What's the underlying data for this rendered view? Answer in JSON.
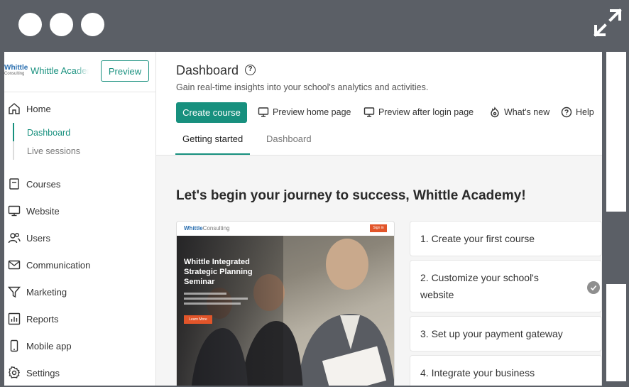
{
  "sidebar": {
    "logo_top": "Whittle",
    "logo_bottom": "Consulting",
    "school_name": "Whittle Academy",
    "preview_label": "Preview",
    "items": [
      {
        "label": "Home",
        "icon": "home-icon"
      },
      {
        "label": "Courses",
        "icon": "book-icon"
      },
      {
        "label": "Website",
        "icon": "monitor-icon"
      },
      {
        "label": "Users",
        "icon": "users-icon"
      },
      {
        "label": "Communication",
        "icon": "mail-icon"
      },
      {
        "label": "Marketing",
        "icon": "funnel-icon"
      },
      {
        "label": "Reports",
        "icon": "bar-chart-icon"
      },
      {
        "label": "Mobile app",
        "icon": "phone-icon"
      },
      {
        "label": "Settings",
        "icon": "gear-icon"
      }
    ],
    "sub_items": [
      "Dashboard",
      "Live sessions"
    ]
  },
  "header": {
    "title": "Dashboard",
    "subtitle": "Gain real-time insights into your school's analytics and activities.",
    "create_label": "Create course",
    "actions": [
      "Preview home page",
      "Preview after login page",
      "What's new",
      "Help"
    ],
    "tabs": [
      "Getting started",
      "Dashboard"
    ]
  },
  "content": {
    "headline": "Let's begin your journey to success, Whittle Academy!",
    "promo": {
      "logo_a": "Whittle",
      "logo_b": "Consulting",
      "signin": "Sign in",
      "title": "Whittle Integrated Strategic Planning Seminar",
      "cta": "Learn More"
    },
    "steps": [
      {
        "label": "1. Create your first course",
        "done": false
      },
      {
        "label": "2. Customize your school's website",
        "done": true
      },
      {
        "label": "3. Set up your payment gateway",
        "done": false
      },
      {
        "label": "4. Integrate your business",
        "done": false
      }
    ]
  },
  "colors": {
    "accent": "#17907e",
    "promo_orange": "#e2552a",
    "frame": "#5b5f66"
  }
}
